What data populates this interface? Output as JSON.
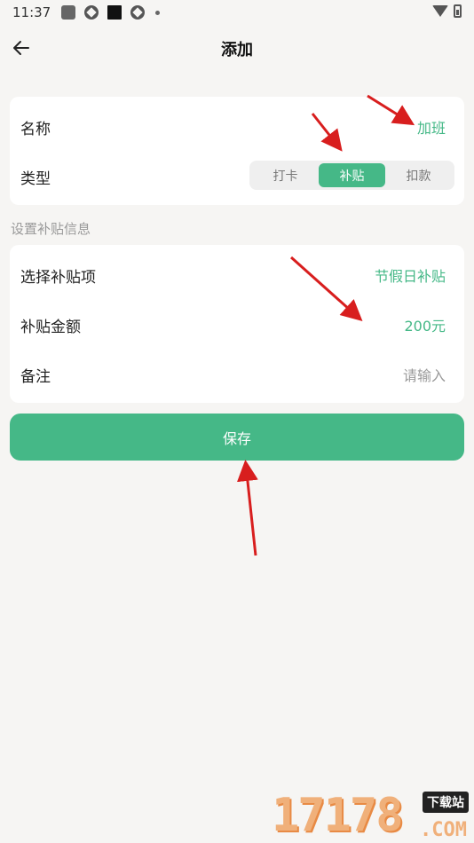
{
  "status_bar": {
    "time": "11:37",
    "icons": [
      "app-icon",
      "compass-icon",
      "square-icon",
      "compass-icon",
      "dot"
    ],
    "right_icons": [
      "wifi-icon",
      "battery-icon"
    ]
  },
  "header": {
    "back_icon": "arrow-left-icon",
    "title": "添加"
  },
  "basic_card": {
    "name_label": "名称",
    "name_value": "加班",
    "type_label": "类型",
    "type_options": [
      "打卡",
      "补贴",
      "扣款"
    ],
    "type_selected": "补贴"
  },
  "subsidy_section": {
    "title": "设置补贴信息",
    "item_label": "选择补贴项",
    "item_value": "节假日补贴",
    "amount_label": "补贴金额",
    "amount_value": "200元",
    "note_label": "备注",
    "note_placeholder": "请输入"
  },
  "save_button": {
    "label": "保存"
  },
  "watermark": {
    "digits": "17178",
    "tag": "下载站",
    "suffix": ".COM"
  },
  "colors": {
    "accent": "#45b887",
    "background": "#f6f5f3",
    "card": "#ffffff",
    "annotation_arrow": "#d81e1e"
  }
}
